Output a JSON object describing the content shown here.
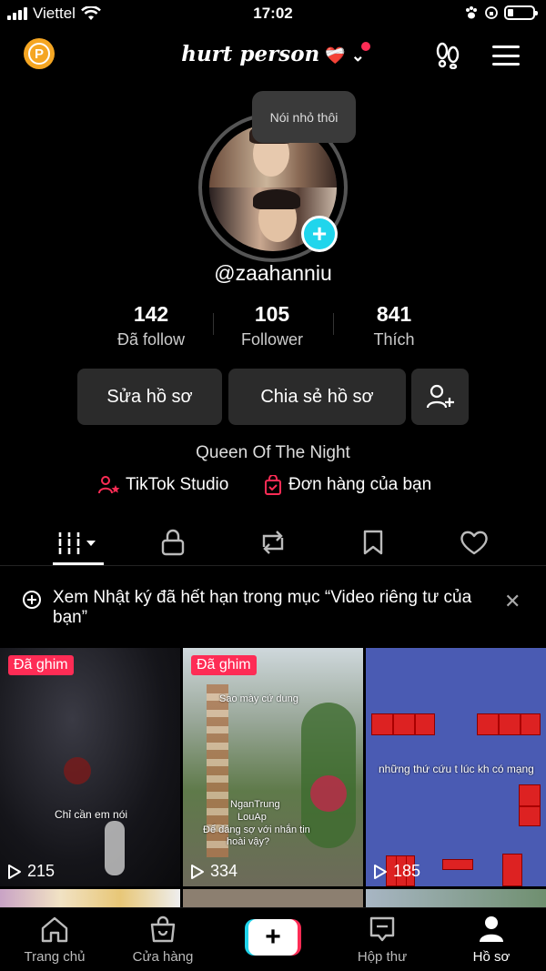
{
  "status_bar": {
    "carrier": "Viettel",
    "time": "17:02"
  },
  "header": {
    "coin_letter": "P",
    "title": "hurt person",
    "title_emoji": "❤️‍🩹",
    "chevron": "⌄"
  },
  "profile": {
    "tooltip": "Nói nhỏ thôi",
    "handle": "@zaahanniu",
    "stats": [
      {
        "value": "142",
        "label": "Đã follow"
      },
      {
        "value": "105",
        "label": "Follower"
      },
      {
        "value": "841",
        "label": "Thích"
      }
    ],
    "edit_button": "Sửa hồ sơ",
    "share_button": "Chia sẻ hồ sơ",
    "bio": "Queen Of The Night",
    "link_studio": "TikTok Studio",
    "link_orders": "Đơn hàng của bạn"
  },
  "banner": {
    "text": "Xem Nhật ký đã hết hạn trong mục “Video riêng tư của bạn”",
    "close": "✕"
  },
  "videos": [
    {
      "pinned_label": "Đã ghim",
      "views": "215",
      "caption": "Chỉ cần em nói"
    },
    {
      "pinned_label": "Đã ghim",
      "views": "334",
      "caption_lines": [
        "Sao mày cứ dung",
        "NganTrung",
        "LouAp",
        "Để đáng sợ với nhắn tin",
        "hoài vậy?"
      ]
    },
    {
      "pinned_label": "",
      "views": "185",
      "caption": "những thứ cứu t lúc kh có mạng"
    }
  ],
  "nav": [
    {
      "label": "Trang chủ"
    },
    {
      "label": "Cửa hàng"
    },
    {
      "label": "+"
    },
    {
      "label": "Hộp thư"
    },
    {
      "label": "Hồ sơ"
    }
  ],
  "colors": {
    "accent_red": "#fe2c55",
    "accent_cyan": "#20d5ec",
    "coin": "#f5a623"
  }
}
